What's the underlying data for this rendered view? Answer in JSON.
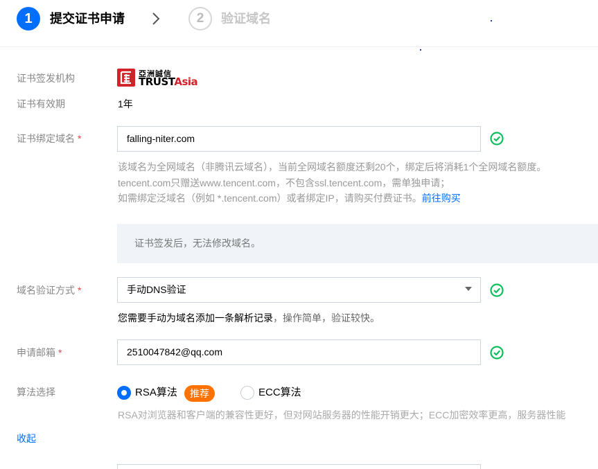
{
  "steps": [
    {
      "number": "1",
      "label": "提交证书申请"
    },
    {
      "number": "2",
      "label": "验证域名"
    }
  ],
  "form": {
    "issuer": {
      "label": "证书签发机构",
      "logo_cn": "亞洲誠信",
      "logo_en_a": "TRUST",
      "logo_en_b": "Asia"
    },
    "validity": {
      "label": "证书有效期",
      "value": "1年"
    },
    "domain": {
      "label": "证书绑定域名",
      "required_mark": "*",
      "value": "falling-niter.com",
      "hint_line1": "该域名为全网域名（非腾讯云域名），当前全网域名额度还剩20个，绑定后将消耗1个全网域名额度。",
      "hint_line2": "tencent.com只赠送www.tencent.com，不包含ssl.tencent.com，需单独申请；",
      "hint_line3": "如需绑定泛域名（例如 *.tencent.com）或者绑定IP，请购买付费证书。",
      "hint_link": "前往购买"
    },
    "notice": "证书签发后，无法修改域名。",
    "verify_method": {
      "label": "域名验证方式",
      "required_mark": "*",
      "selected": "手动DNS验证",
      "desc_strong": "您需要手动为域名添加一条解析记录",
      "desc_muted": "，操作简单，验证较快。"
    },
    "email": {
      "label": "申请邮箱",
      "required_mark": "*",
      "value": "2510047842@qq.com"
    },
    "algorithm": {
      "label": "算法选择",
      "options": [
        {
          "label": "RSA算法",
          "selected": true
        },
        {
          "label": "ECC算法",
          "selected": false
        }
      ],
      "badge": "推荐",
      "hint": "RSA对浏览器和客户端的兼容性更好，但对网站服务器的性能开销更大；ECC加密效率更高，服务器性能"
    },
    "collapse": "收起"
  },
  "colors": {
    "primary": "#006eff",
    "success": "#0abf5b",
    "badge": "#ff7200",
    "required": "#e54545"
  },
  "icons": {
    "check": "check-circle-icon",
    "chevron": "chevron-right-icon",
    "dropdown": "caret-down-icon"
  }
}
